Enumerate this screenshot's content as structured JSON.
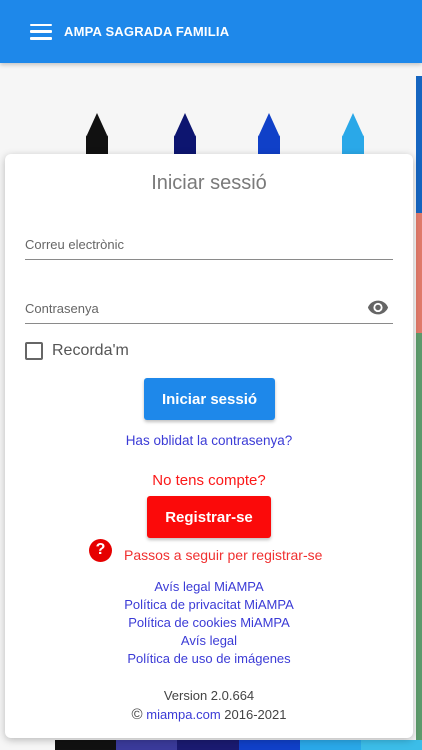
{
  "app": {
    "title": "AMPA SAGRADA FAMILIA"
  },
  "login": {
    "title": "Iniciar sessió",
    "email_placeholder": "Correu electrònic",
    "password_placeholder": "Contrasenya",
    "remember_label": "Recorda'm",
    "login_button": "Iniciar sessió",
    "forgot_link": "Has oblidat la contrasenya?",
    "no_account_text": "No tens compte?",
    "register_button": "Registrar-se",
    "steps_link": "Passos a seguir per registrar-se"
  },
  "legal_links": [
    "Avís legal MiAMPA",
    "Política de privacitat MiAMPA",
    "Política de cookies MiAMPA",
    "Avís legal",
    "Política de uso de imágenes"
  ],
  "footer": {
    "version": "Version 2.0.664",
    "copyright_symbol": "©",
    "site": "miampa.com",
    "years": "2016-2021"
  },
  "colors": {
    "primary": "#1e88ea",
    "danger": "#fb0a0a",
    "link": "#3b3bd6"
  },
  "icons": {
    "menu": "hamburger-menu-icon",
    "password_toggle": "eye-icon",
    "help": "question-circle-icon"
  }
}
